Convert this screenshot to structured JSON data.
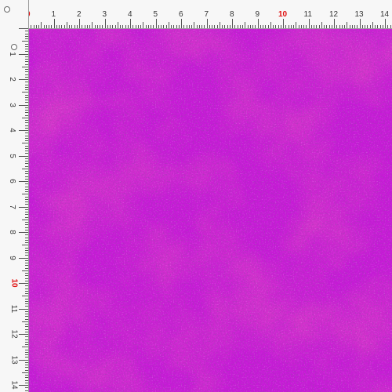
{
  "ruler": {
    "units": "cm",
    "labels": [
      "0",
      "1",
      "2",
      "3",
      "4",
      "5",
      "6",
      "7",
      "8",
      "9",
      "10",
      "11",
      "12",
      "13",
      "14"
    ],
    "highlight_color": "#e01010"
  },
  "fabric": {
    "colors": {
      "base": "#c61ad6",
      "dark": "#8e1aa8",
      "light": "#e040ee",
      "pink": "#d1188a"
    },
    "pattern": "sparkle texture"
  }
}
